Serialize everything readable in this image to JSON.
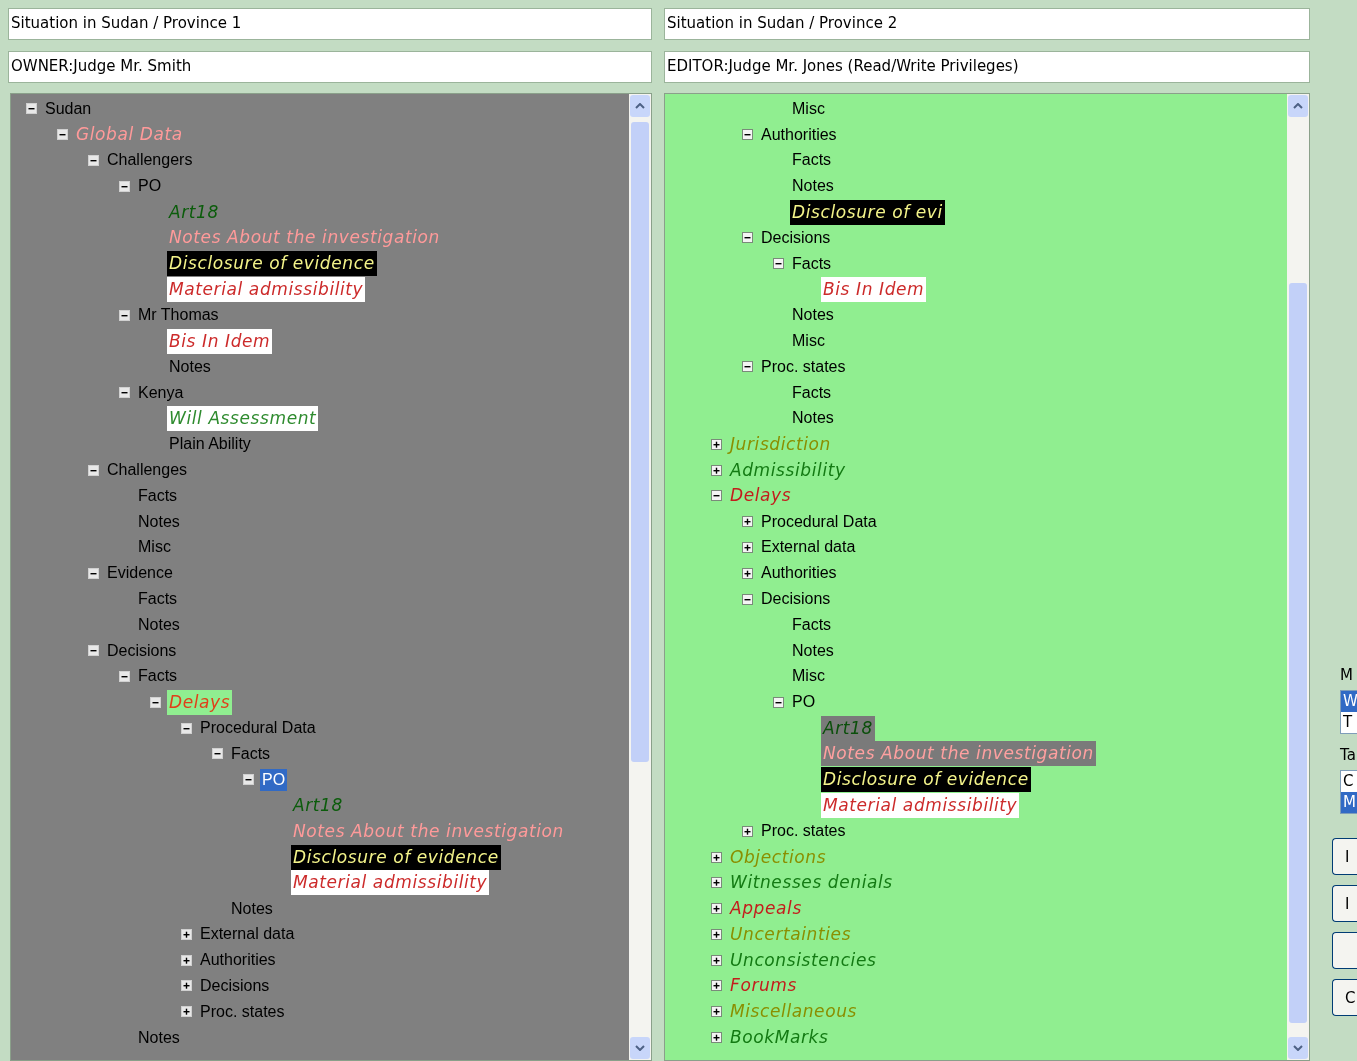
{
  "left_panel": {
    "title": "Situation in Sudan / Province 1",
    "owner": "OWNER:Judge Mr. Smith",
    "tree": [
      {
        "label": "Sudan",
        "kind": "plain",
        "expanded": true,
        "selected": false,
        "children": [
          {
            "label": "Global Data",
            "kind": "red",
            "expanded": true,
            "selected": false,
            "children": [
              {
                "label": "Challengers",
                "kind": "plain",
                "expanded": true,
                "selected": false,
                "children": [
                  {
                    "label": "PO",
                    "kind": "plain",
                    "expanded": true,
                    "selected": false,
                    "children": [
                      {
                        "label": "Art18",
                        "kind": "green",
                        "selected": false
                      },
                      {
                        "label": "Notes About the investigation",
                        "kind": "red",
                        "selected": false
                      },
                      {
                        "label": "Disclosure of evidence",
                        "kind": "highlighted",
                        "selected": false
                      },
                      {
                        "label": "Material admissibility",
                        "kind": "redmarked",
                        "selected": false
                      }
                    ]
                  },
                  {
                    "label": "Mr Thomas",
                    "kind": "plain",
                    "expanded": true,
                    "selected": false,
                    "children": [
                      {
                        "label": "Bis In Idem",
                        "kind": "redmarked",
                        "selected": false
                      },
                      {
                        "label": "Notes",
                        "kind": "plain",
                        "selected": false
                      }
                    ]
                  },
                  {
                    "label": "Kenya",
                    "kind": "plain",
                    "expanded": true,
                    "selected": false,
                    "children": [
                      {
                        "label": "Will Assessment",
                        "kind": "greenmarked",
                        "selected": false
                      },
                      {
                        "label": "Plain Ability",
                        "kind": "plain",
                        "selected": false
                      }
                    ]
                  }
                ]
              },
              {
                "label": "Challenges",
                "kind": "plain",
                "expanded": true,
                "selected": false,
                "children": [
                  {
                    "label": "Facts",
                    "kind": "plain",
                    "selected": false
                  },
                  {
                    "label": "Notes",
                    "kind": "plain",
                    "selected": false
                  },
                  {
                    "label": "Misc",
                    "kind": "plain",
                    "selected": false
                  }
                ]
              },
              {
                "label": "Evidence",
                "kind": "plain",
                "expanded": true,
                "selected": false,
                "children": [
                  {
                    "label": "Facts",
                    "kind": "plain",
                    "selected": false
                  },
                  {
                    "label": "Notes",
                    "kind": "plain",
                    "selected": false
                  }
                ]
              },
              {
                "label": "Decisions",
                "kind": "plain",
                "expanded": true,
                "selected": false,
                "children": [
                  {
                    "label": "Facts",
                    "kind": "plain",
                    "expanded": true,
                    "selected": false,
                    "children": [
                      {
                        "label": "Delays",
                        "kind": "redgreen",
                        "expanded": true,
                        "selected": false,
                        "children": [
                          {
                            "label": "Procedural Data",
                            "kind": "plain",
                            "expanded": true,
                            "selected": false,
                            "children": [
                              {
                                "label": "Facts",
                                "kind": "plain",
                                "expanded": true,
                                "selected": false,
                                "children": [
                                  {
                                    "label": "PO",
                                    "kind": "plain",
                                    "expanded": true,
                                    "selected": true,
                                    "children": [
                                      {
                                        "label": "Art18",
                                        "kind": "green",
                                        "selected": false
                                      },
                                      {
                                        "label": "Notes About the investigation",
                                        "kind": "red",
                                        "selected": false
                                      },
                                      {
                                        "label": "Disclosure of evidence",
                                        "kind": "highlighted",
                                        "selected": false
                                      },
                                      {
                                        "label": "Material admissibility",
                                        "kind": "redmarked",
                                        "selected": false
                                      }
                                    ]
                                  }
                                ]
                              },
                              {
                                "label": "Notes",
                                "kind": "plain",
                                "selected": false
                              }
                            ]
                          },
                          {
                            "label": "External data",
                            "kind": "plain",
                            "expanded": false,
                            "selected": false
                          },
                          {
                            "label": "Authorities",
                            "kind": "plain",
                            "expanded": false,
                            "selected": false
                          },
                          {
                            "label": "Decisions",
                            "kind": "plain",
                            "expanded": false,
                            "selected": false
                          },
                          {
                            "label": "Proc. states",
                            "kind": "plain",
                            "expanded": false,
                            "selected": false
                          }
                        ]
                      }
                    ]
                  },
                  {
                    "label": "Notes",
                    "kind": "plain",
                    "selected": false
                  }
                ]
              }
            ]
          }
        ]
      }
    ]
  },
  "right_panel": {
    "title": "Situation in Sudan / Province 2",
    "owner": "EDITOR:Judge Mr. Jones (Read/Write Privileges)",
    "tree": [
      {
        "children": [
          {
            "children": [
              {
                "children": [
                  {
                    "label": "Misc",
                    "kind": "plain",
                    "selected": false
                  }
                ]
              },
              {
                "label": "Authorities",
                "kind": "plain",
                "expanded": true,
                "selected": false,
                "children": [
                  {
                    "label": "Facts",
                    "kind": "plain",
                    "selected": false
                  },
                  {
                    "label": "Notes",
                    "kind": "plain",
                    "selected": false
                  },
                  {
                    "label": "Disclosure of evi",
                    "kind": "highlighted",
                    "selected": false
                  }
                ]
              },
              {
                "label": "Decisions",
                "kind": "plain",
                "expanded": true,
                "selected": false,
                "children": [
                  {
                    "label": "Facts",
                    "kind": "plain",
                    "expanded": true,
                    "selected": false,
                    "children": [
                      {
                        "label": "Bis In Idem",
                        "kind": "redmarked",
                        "selected": false
                      }
                    ]
                  },
                  {
                    "label": "Notes",
                    "kind": "plain",
                    "selected": false
                  },
                  {
                    "label": "Misc",
                    "kind": "plain",
                    "selected": false
                  }
                ]
              },
              {
                "label": "Proc. states",
                "kind": "plain",
                "expanded": true,
                "selected": false,
                "children": [
                  {
                    "label": "Facts",
                    "kind": "plain",
                    "selected": false
                  },
                  {
                    "label": "Notes",
                    "kind": "plain",
                    "selected": false
                  }
                ]
              }
            ]
          },
          {
            "label": "Jurisdiction",
            "kind": "yellow",
            "expanded": false,
            "selected": false
          },
          {
            "label": "Admissibility",
            "kind": "green",
            "expanded": false,
            "selected": false
          },
          {
            "label": "Delays",
            "kind": "red",
            "expanded": true,
            "selected": false,
            "children": [
              {
                "label": "Procedural Data",
                "kind": "plain",
                "expanded": false,
                "selected": false
              },
              {
                "label": "External data",
                "kind": "plain",
                "expanded": false,
                "selected": false
              },
              {
                "label": "Authorities",
                "kind": "plain",
                "expanded": false,
                "selected": false
              },
              {
                "label": "Decisions",
                "kind": "plain",
                "expanded": true,
                "selected": false,
                "children": [
                  {
                    "label": "Facts",
                    "kind": "plain",
                    "selected": false
                  },
                  {
                    "label": "Notes",
                    "kind": "plain",
                    "selected": false
                  },
                  {
                    "label": "Misc",
                    "kind": "plain",
                    "selected": false
                  },
                  {
                    "label": "PO",
                    "kind": "plain",
                    "expanded": true,
                    "selected": false,
                    "children": [
                      {
                        "label": "Art18",
                        "kind": "greengrey",
                        "selected": false
                      },
                      {
                        "label": "Notes About the investigation",
                        "kind": "redgrey",
                        "selected": false
                      },
                      {
                        "label": "Disclosure of evidence",
                        "kind": "highlighted",
                        "selected": false
                      },
                      {
                        "label": "Material admissibility",
                        "kind": "redmarked",
                        "selected": false
                      }
                    ]
                  }
                ]
              },
              {
                "label": "Proc. states",
                "kind": "plain",
                "expanded": false,
                "selected": false
              }
            ]
          },
          {
            "label": "Objections",
            "kind": "yellow",
            "expanded": false,
            "selected": false
          },
          {
            "label": "Witnesses denials",
            "kind": "green",
            "expanded": false,
            "selected": false
          },
          {
            "label": "Appeals",
            "kind": "red",
            "expanded": false,
            "selected": false
          },
          {
            "label": "Uncertainties",
            "kind": "yellow",
            "expanded": false,
            "selected": false
          },
          {
            "label": "Unconsistencies",
            "kind": "green",
            "expanded": false,
            "selected": false
          },
          {
            "label": "Forums",
            "kind": "red",
            "expanded": false,
            "selected": false
          },
          {
            "label": "Miscellaneous",
            "kind": "yellow",
            "expanded": false,
            "selected": false
          },
          {
            "label": "BookMarks",
            "kind": "green",
            "expanded": false,
            "selected": false
          }
        ]
      }
    ]
  },
  "side_strip": {
    "label_1": "M",
    "list_1": [
      {
        "label": "W",
        "selected": true
      },
      {
        "label": "T",
        "selected": false
      }
    ],
    "label_2": "Ta",
    "list_2": [
      {
        "label": "C",
        "selected": false
      },
      {
        "label": "M",
        "selected": true
      }
    ],
    "buttons": [
      {
        "kind": "button",
        "label": "I"
      },
      {
        "kind": "button",
        "label": "I"
      },
      {
        "kind": "button"
      },
      {
        "kind": "button",
        "label": "C"
      }
    ]
  }
}
